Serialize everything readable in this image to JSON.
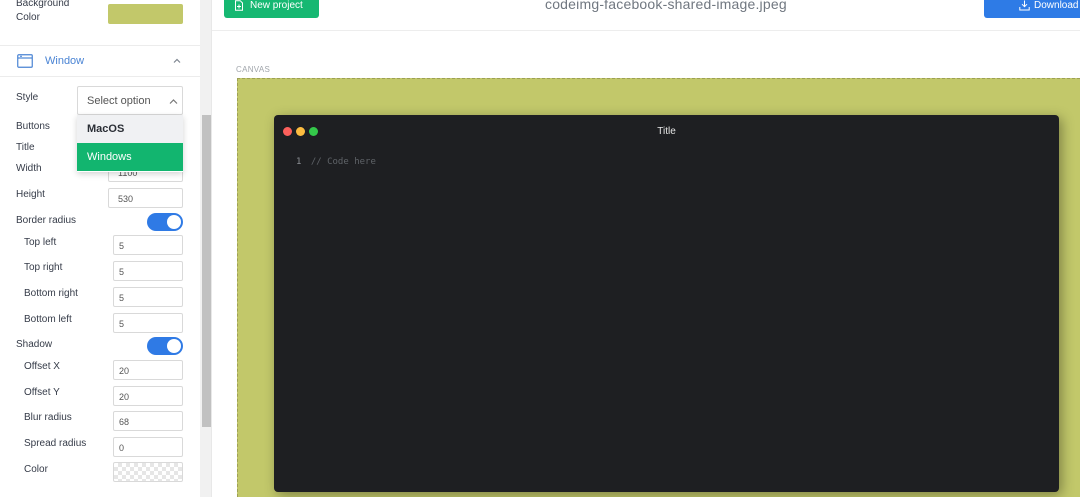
{
  "header": {
    "new_project": "New project",
    "file_name": "codeimg-facebook-shared-image.jpeg",
    "download": "Download"
  },
  "sidebar": {
    "background_color_label": "Background\nColor",
    "background_color_value": "#c2c86a",
    "window_section": "Window",
    "style": {
      "label": "Style",
      "placeholder": "Select option",
      "options": [
        "MacOS",
        "Windows"
      ],
      "highlighted": "Windows"
    },
    "buttons_label": "Buttons",
    "title_label": "Title",
    "width": {
      "label": "Width",
      "value": "1100"
    },
    "height": {
      "label": "Height",
      "value": "530"
    },
    "border_radius": {
      "label": "Border radius",
      "enabled": true,
      "top_left": {
        "label": "Top left",
        "value": "5"
      },
      "top_right": {
        "label": "Top right",
        "value": "5"
      },
      "bottom_right": {
        "label": "Bottom right",
        "value": "5"
      },
      "bottom_left": {
        "label": "Bottom left",
        "value": "5"
      }
    },
    "shadow": {
      "label": "Shadow",
      "enabled": true,
      "offset_x": {
        "label": "Offset X",
        "value": "20"
      },
      "offset_y": {
        "label": "Offset Y",
        "value": "20"
      },
      "blur_radius": {
        "label": "Blur radius",
        "value": "68"
      },
      "spread_radius": {
        "label": "Spread radius",
        "value": "0"
      },
      "color_label": "Color"
    }
  },
  "canvas": {
    "label": "CANVAS",
    "window_title": "Title",
    "code_line_number": "1",
    "code_text": "// Code here"
  },
  "colors": {
    "canvas_bg": "#c2c86a",
    "accent_green": "#16b872",
    "accent_blue": "#2e7be6",
    "window_bg": "#1e1f22",
    "toggle_on": "#2f7ae5"
  }
}
